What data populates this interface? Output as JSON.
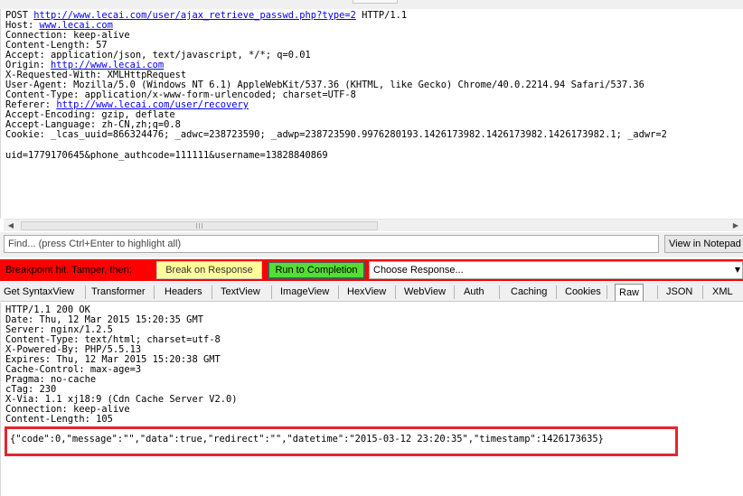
{
  "request": {
    "lines": [
      {
        "parts": [
          {
            "t": "POST "
          },
          {
            "t": "http://www.lecai.com/user/ajax_retrieve_passwd.php?type=2",
            "link": true
          },
          {
            "t": " HTTP/1.1"
          }
        ]
      },
      {
        "parts": [
          {
            "t": "Host: "
          },
          {
            "t": "www.lecai.com",
            "link": true
          }
        ]
      },
      {
        "parts": [
          {
            "t": "Connection: keep-alive"
          }
        ]
      },
      {
        "parts": [
          {
            "t": "Content-Length: 57"
          }
        ]
      },
      {
        "parts": [
          {
            "t": "Accept: application/json, text/javascript, */*; q=0.01"
          }
        ]
      },
      {
        "parts": [
          {
            "t": "Origin: "
          },
          {
            "t": "http://www.lecai.com",
            "link": true
          }
        ]
      },
      {
        "parts": [
          {
            "t": "X-Requested-With: XMLHttpRequest"
          }
        ]
      },
      {
        "parts": [
          {
            "t": "User-Agent: Mozilla/5.0 (Windows NT 6.1) AppleWebKit/537.36 (KHTML, like Gecko) Chrome/40.0.2214.94 Safari/537.36"
          }
        ]
      },
      {
        "parts": [
          {
            "t": "Content-Type: application/x-www-form-urlencoded; charset=UTF-8"
          }
        ]
      },
      {
        "parts": [
          {
            "t": "Referer: "
          },
          {
            "t": "http://www.lecai.com/user/recovery",
            "link": true
          }
        ]
      },
      {
        "parts": [
          {
            "t": "Accept-Encoding: gzip, deflate"
          }
        ]
      },
      {
        "parts": [
          {
            "t": "Accept-Language: zh-CN,zh;q=0.8"
          }
        ]
      },
      {
        "parts": [
          {
            "t": "Cookie: _lcas_uuid=866324476; _adwc=238723590; _adwp=238723590.9976280193.1426173982.1426173982.1426173982.1; _adwr=2"
          }
        ]
      }
    ],
    "body": "uid=1779170645&phone_authcode=111111&username=13828840869"
  },
  "find": {
    "placeholder": "Find... (press Ctrl+Enter to highlight all)",
    "view_in_notepad": "View in Notepad"
  },
  "breakpoint": {
    "label": "Breakpoint hit. Tamper, then:",
    "break_on_response": "Break on Response",
    "run_to_completion": "Run to Completion",
    "choose_response": "Choose Response..."
  },
  "response_tabs": [
    {
      "label": "Get SyntaxView"
    },
    {
      "label": "Transformer"
    },
    {
      "label": "Headers"
    },
    {
      "label": "TextView"
    },
    {
      "label": "ImageView"
    },
    {
      "label": "HexView"
    },
    {
      "label": "WebView"
    },
    {
      "label": "Auth"
    },
    {
      "label": "Caching"
    },
    {
      "label": "Cookies"
    },
    {
      "label": "Raw",
      "active": true
    },
    {
      "label": "JSON"
    },
    {
      "label": "XML"
    }
  ],
  "response": {
    "headers": [
      "HTTP/1.1 200 OK",
      "Date: Thu, 12 Mar 2015 15:20:35 GMT",
      "Server: nginx/1.2.5",
      "Content-Type: text/html; charset=utf-8",
      "X-Powered-By: PHP/5.5.13",
      "Expires: Thu, 12 Mar 2015 15:20:38 GMT",
      "Cache-Control: max-age=3",
      "Pragma: no-cache",
      "cTag: 230",
      "X-Via: 1.1 xj18:9 (Cdn Cache Server V2.0)",
      "Connection: keep-alive",
      "Content-Length: 105"
    ],
    "body": "{\"code\":0,\"message\":\"\",\"data\":true,\"redirect\":\"\",\"datetime\":\"2015-03-12 23:20:35\",\"timestamp\":1426173635}"
  },
  "colors": {
    "breakpoint_bar": "#ff0000",
    "break_on_response_bg": "#ffff99",
    "run_to_completion_bg": "#55dd33",
    "highlight_box": "#e0282d",
    "link": "#0000ee"
  }
}
